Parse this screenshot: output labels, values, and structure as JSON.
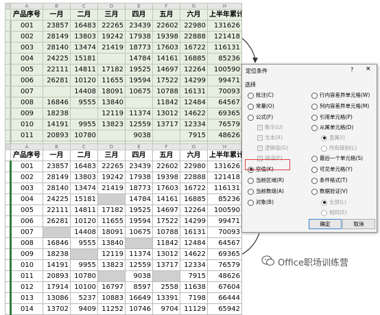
{
  "columns": [
    "A",
    "B",
    "C",
    "D",
    "E",
    "F",
    "G",
    "H"
  ],
  "headers": [
    "产品序号",
    "一月",
    "二月",
    "三月",
    "四月",
    "五月",
    "六月",
    "上半年累计"
  ],
  "rows": [
    [
      "001",
      "23857",
      "16483",
      "22265",
      "23439",
      "22602",
      "22980",
      "131626"
    ],
    [
      "002",
      "28149",
      "13803",
      "19242",
      "17938",
      "19398",
      "22888",
      "121418"
    ],
    [
      "003",
      "28140",
      "13474",
      "21419",
      "18773",
      "17603",
      "16722",
      "116131"
    ],
    [
      "004",
      "24225",
      "15181",
      "",
      "14784",
      "14161",
      "16885",
      "85236"
    ],
    [
      "005",
      "22111",
      "14811",
      "17182",
      "19525",
      "14697",
      "12264",
      "100590"
    ],
    [
      "006",
      "26281",
      "10120",
      "11655",
      "19594",
      "17522",
      "14299",
      "99471"
    ],
    [
      "007",
      "",
      "14408",
      "18091",
      "10675",
      "10788",
      "16131",
      "70093"
    ],
    [
      "008",
      "16846",
      "9555",
      "13840",
      "",
      "11842",
      "12484",
      "64567"
    ],
    [
      "009",
      "18238",
      "",
      "12119",
      "11374",
      "13012",
      "14622",
      "69365"
    ],
    [
      "010",
      "14191",
      "9955",
      "13823",
      "12559",
      "13717",
      "12334",
      "76579"
    ],
    [
      "011",
      "20893",
      "10780",
      "",
      "9038",
      "",
      "7915",
      "48626"
    ],
    [
      "012",
      "17914",
      "10100",
      "16797",
      "8597",
      "2558",
      "11638",
      "67604"
    ],
    [
      "013",
      "13086",
      "5237",
      "10883",
      "16649",
      "13391",
      "7198",
      "66444"
    ],
    [
      "014",
      "13702",
      "9409",
      "11252",
      "10746",
      "9704",
      "11129",
      "65942"
    ]
  ],
  "dialog": {
    "title": "定位条件",
    "help": "?",
    "close": "✕",
    "section": "选择",
    "left_options": [
      "批注(C)",
      "常量(O)",
      "公式(F)",
      "数字(U)",
      "文本(X)",
      "逻辑值(G)",
      "错误(E)",
      "空值(K)",
      "当前区域(R)",
      "当前数组(A)",
      "对象(B)"
    ],
    "right_options": [
      "行内容差异单元格(W)",
      "列内容差异单元格(M)",
      "引用单元格(P)",
      "从属单元格(D)",
      "直属(I)",
      "所有级别(L)",
      "最后一个单元格(S)",
      "可见单元格(Y)",
      "条件格式(T)",
      "数据验证(V)",
      "全部(L)",
      "相同(E)"
    ],
    "selected": "空值(K)",
    "ok": "确定",
    "cancel": "取消"
  },
  "watermark": "Office职场训练营",
  "colors": {
    "highlight": "#e33e3e",
    "sheet_bg": "#e7efe1",
    "blank_fill": "#cfcfcf"
  }
}
